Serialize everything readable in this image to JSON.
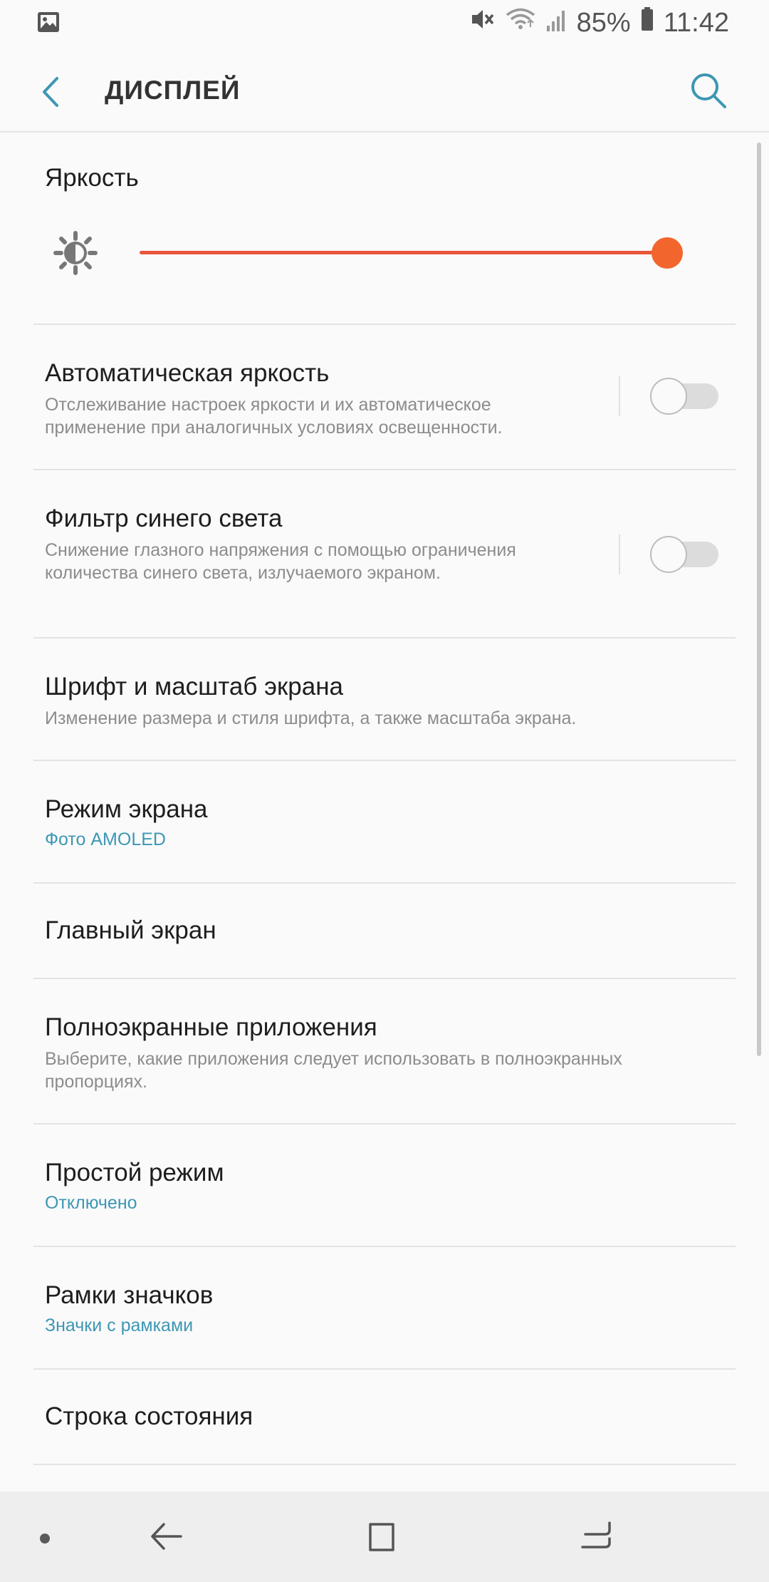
{
  "status_bar": {
    "battery_percent": "85%",
    "time": "11:42",
    "icons": [
      "gallery-notification-icon",
      "mute-icon",
      "wifi-icon",
      "signal-icon",
      "battery-icon"
    ]
  },
  "app_bar": {
    "title": "ДИСПЛЕЙ",
    "back_icon": "chevron-left-icon",
    "search_icon": "search-icon"
  },
  "brightness": {
    "label": "Яркость",
    "level": 1.0,
    "accent": "#f2662e"
  },
  "settings": {
    "auto_brightness": {
      "title": "Автоматическая яркость",
      "subtitle": "Отслеживание настроек яркости и их автоматическое применение при аналогичных условиях освещенности.",
      "enabled": false
    },
    "blue_light": {
      "title": "Фильтр синего света",
      "subtitle": "Снижение глазного напряжения с помощью ограничения количества синего света, излучаемого экраном.",
      "enabled": false
    },
    "font_scale": {
      "title": "Шрифт и масштаб экрана",
      "subtitle": "Изменение размера и стиля шрифта, а также масштаба экрана."
    },
    "screen_mode": {
      "title": "Режим экрана",
      "value": "Фото AMOLED"
    },
    "home_screen": {
      "title": "Главный экран"
    },
    "fullscreen_apps": {
      "title": "Полноэкранные приложения",
      "subtitle": "Выберите, какие приложения следует использовать в полноэкранных пропорциях."
    },
    "easy_mode": {
      "title": "Простой режим",
      "value": "Отключено"
    },
    "icon_frames": {
      "title": "Рамки значков",
      "value": "Значки с рамками"
    },
    "status_bar_setting": {
      "title": "Строка состояния"
    }
  },
  "colors": {
    "accent_value": "#3d97b3",
    "slider": "#f2662e"
  }
}
